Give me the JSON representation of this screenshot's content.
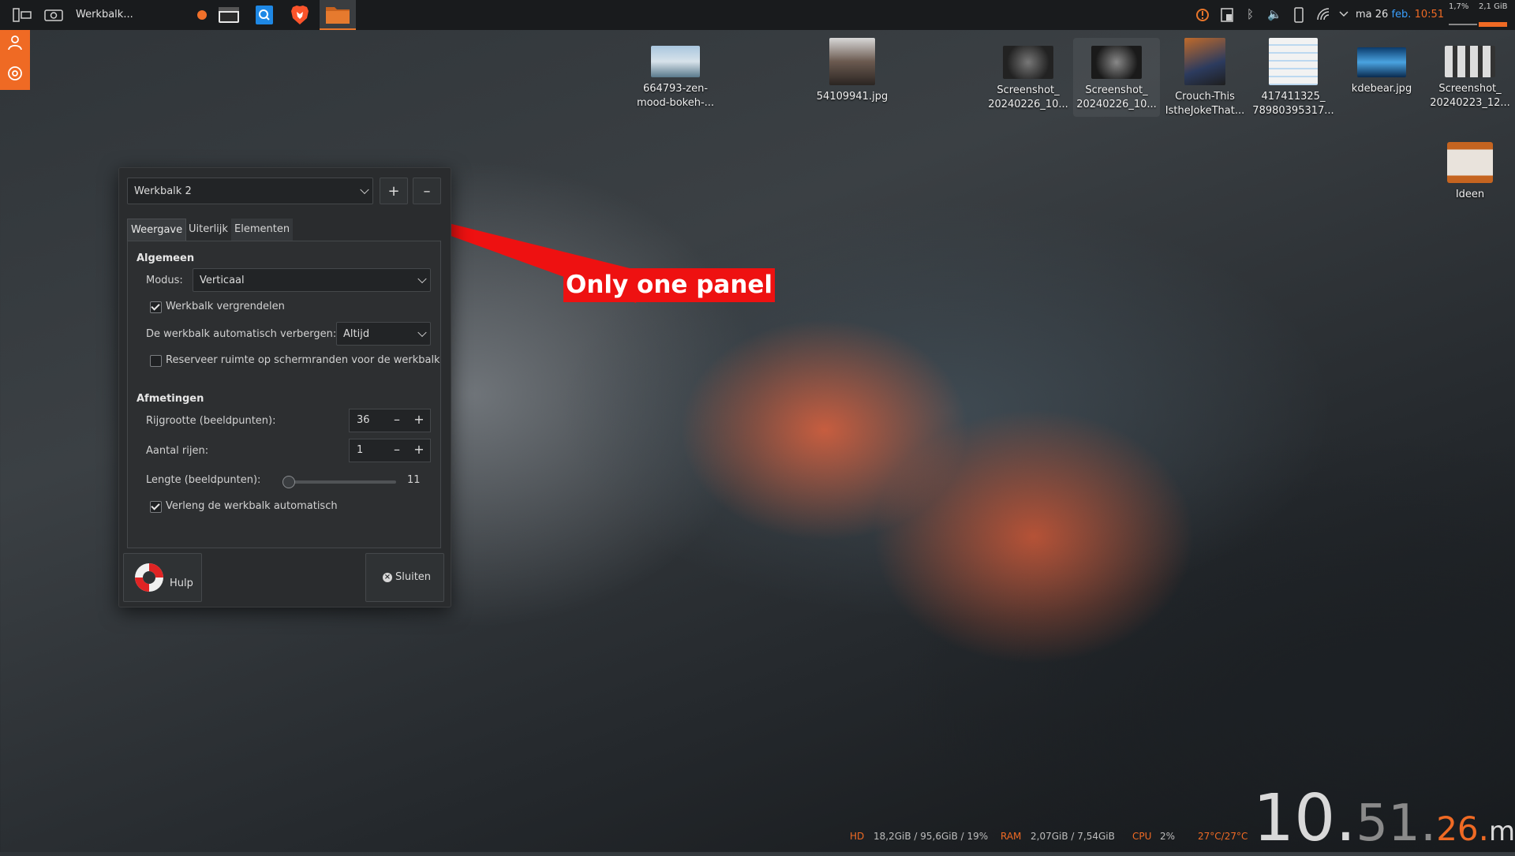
{
  "taskbar": {
    "window_title": "Werkbalk...",
    "tasks": [
      {
        "name": "orange-dot-icon"
      },
      {
        "name": "terminal-icon"
      },
      {
        "name": "search-app-icon"
      },
      {
        "name": "brave-icon"
      },
      {
        "name": "file-manager-icon"
      }
    ],
    "tray": [
      "update-icon",
      "clipboard-icon",
      "bluetooth-icon",
      "volume-icon",
      "phone-icon",
      "network-icon",
      "expand-chevron-icon"
    ],
    "clock": {
      "day": "ma 26",
      "month": "feb.",
      "time": "10:51"
    },
    "cpu_mini": "1,7%",
    "mem_mini": "2,1 GiB"
  },
  "desktop_icons": [
    {
      "label": "664793-zen-\nmood-bokeh-..."
    },
    {
      "label": "54109941.jpg"
    },
    {
      "label": "Screenshot_\n20240226_10..."
    },
    {
      "label": "Screenshot_\n20240226_10..."
    },
    {
      "label": "Crouch-This\nIstheJokeThat..."
    },
    {
      "label": "417411325_\n78980395317..."
    },
    {
      "label": "kdebear.jpg"
    },
    {
      "label": "Screenshot_\n20240223_12..."
    },
    {
      "label": "Ideen"
    }
  ],
  "dialog": {
    "panel_select": "Werkbalk 2",
    "add": "+",
    "remove": "–",
    "tabs": [
      "Weergave",
      "Uiterlijk",
      "Elementen"
    ],
    "active_tab": "Weergave",
    "general": {
      "heading": "Algemeen",
      "mode_label": "Modus:",
      "mode_value": "Verticaal",
      "lock_label": "Werkbalk vergrendelen",
      "lock_checked": true,
      "autohide_label": "De werkbalk automatisch verbergen:",
      "autohide_value": "Altijd",
      "reserve_label": "Reserveer ruimte op schermranden voor de werkbalk",
      "reserve_checked": false
    },
    "dimensions": {
      "heading": "Afmetingen",
      "row_size_label": "Rijgrootte (beeldpunten):",
      "row_size_value": "36",
      "rows_label": "Aantal rijen:",
      "rows_value": "1",
      "length_label": "Lengte (beeldpunten):",
      "length_value": "11",
      "extend_label": "Verleng de werkbalk automatisch",
      "extend_checked": true
    },
    "help_button": "Hulp",
    "close_button": "Sluiten"
  },
  "annotation": "Only one panel",
  "bottom": {
    "hd_label": "HD",
    "hd_value": "18,2GiB / 95,6GiB / 19%",
    "ram_label": "RAM",
    "ram_value": "2,07GiB / 7,54GiB",
    "cpu_label": "CPU",
    "cpu_value": "2%",
    "temp_value": "27°C/27°C",
    "clock_h": "10.",
    "clock_m": "51.",
    "clock_s": "26.",
    "clock_day": "ma"
  },
  "colors": {
    "accent": "#ef6a24",
    "blue": "#3aa0ff",
    "annotation": "#ee1111"
  }
}
